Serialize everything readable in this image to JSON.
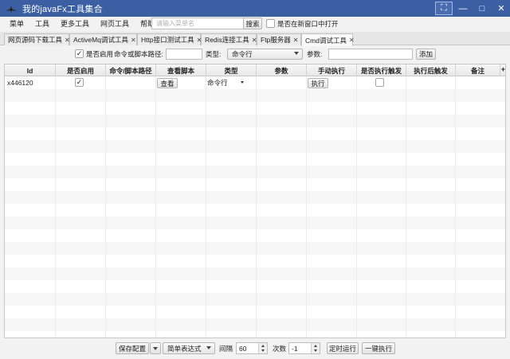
{
  "window": {
    "title": "我的javaFx工具集合",
    "buttons": [
      "⛶",
      "—",
      "□",
      "✕"
    ]
  },
  "menubar": {
    "items": [
      "菜单",
      "工具",
      "更多工具",
      "网页工具",
      "帮助"
    ],
    "search_placeholder": "请输入菜单名",
    "search_button": "搜索",
    "new_window_label": "是否在新窗口中打开",
    "new_window_checked": false
  },
  "tabs": [
    {
      "label": "网页源码下载工具",
      "selected": false
    },
    {
      "label": "ActiveMq调试工具",
      "selected": false
    },
    {
      "label": "Http接口测试工具",
      "selected": false
    },
    {
      "label": "Redis连接工具",
      "selected": false
    },
    {
      "label": "Ftp服务器",
      "selected": false
    },
    {
      "label": "Cmd调试工具",
      "selected": true
    }
  ],
  "toolbar": {
    "enabled_label": "是否启用",
    "enabled_checked": true,
    "path_label": "命令或脚本路径:",
    "path_value": "",
    "type_label": "类型:",
    "type_value": "命令行",
    "params_label": "参数:",
    "params_value": "",
    "add_button": "添加"
  },
  "table": {
    "columns": [
      "Id",
      "是否启用",
      "命令/脚本路径",
      "查看脚本",
      "类型",
      "参数",
      "手动执行",
      "是否执行触发",
      "执行后触发",
      "备注"
    ],
    "plus": "+",
    "rows": [
      {
        "id": "x446120",
        "enabled": true,
        "path": "",
        "view_button": "查看",
        "type": "命令行",
        "params": "",
        "run_button": "执行",
        "trigger": false,
        "after": "",
        "note": ""
      }
    ]
  },
  "bottombar": {
    "save_config": "保存配置",
    "expression_type": "简单表达式",
    "interval_label": "间隔",
    "interval_value": "60",
    "count_label": "次数",
    "count_value": "-1",
    "timed_run": "定时运行",
    "run_all": "一键执行"
  }
}
